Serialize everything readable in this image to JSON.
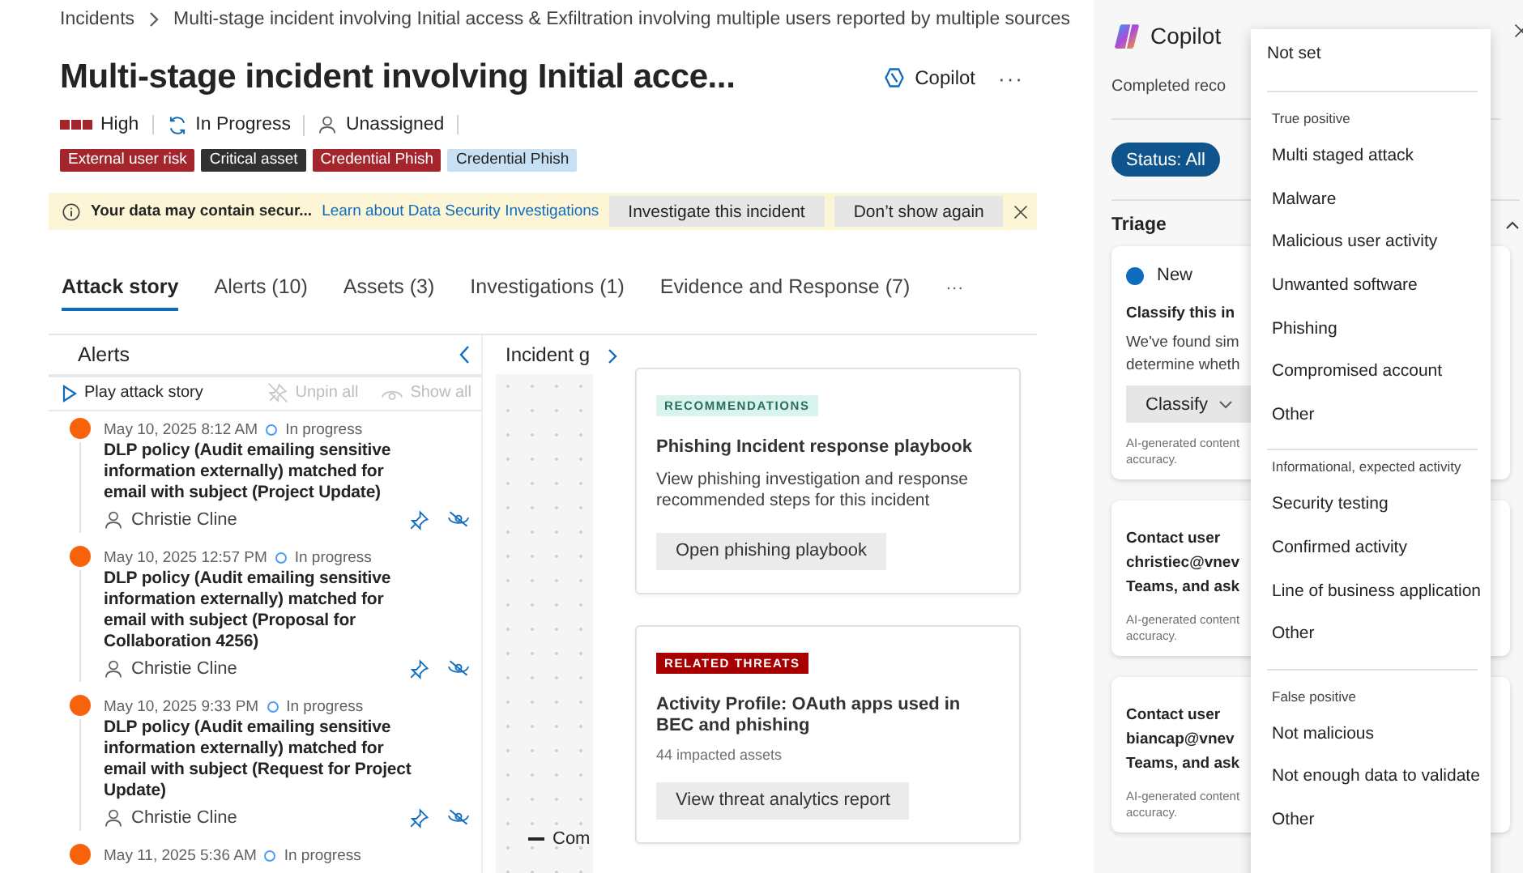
{
  "breadcrumb": {
    "root": "Incidents",
    "current": "Multi-stage incident involving Initial access & Exfiltration involving multiple users reported by multiple sources"
  },
  "title": "Multi-stage incident involving Initial acce...",
  "header_actions": {
    "copilot": "Copilot",
    "more": "···"
  },
  "status": {
    "severity": "High",
    "state": "In Progress",
    "assignee": "Unassigned"
  },
  "tags": [
    {
      "label": "External user risk",
      "color": "#a4262c"
    },
    {
      "label": "Critical asset",
      "color": "#323130"
    },
    {
      "label": "Credential Phish",
      "color": "#a4262c"
    },
    {
      "label": "Credential Phish",
      "color": "#c7e0f4"
    }
  ],
  "banner": {
    "message": "Your data may contain secur...",
    "link": "Learn about Data Security Investigations",
    "buttons": [
      "Investigate this incident",
      "Don’t show again"
    ]
  },
  "tabs": [
    {
      "label": "Attack story",
      "selected": true
    },
    {
      "label": "Alerts (10)",
      "selected": false
    },
    {
      "label": "Assets (3)",
      "selected": false
    },
    {
      "label": "Investigations (1)",
      "selected": false
    },
    {
      "label": "Evidence and Response (7)",
      "selected": false
    }
  ],
  "tabs_more": "···",
  "alerts_panel": {
    "title": "Alerts",
    "toolbar": [
      {
        "kind": "play",
        "label": "Play attack story",
        "disabled": false
      },
      {
        "kind": "unpin",
        "label": "Unpin all",
        "disabled": true
      },
      {
        "kind": "show",
        "label": "Show all",
        "disabled": true
      }
    ],
    "alerts": [
      {
        "time": "May 10, 2025 8:12 AM",
        "status": "In progress",
        "title": "DLP policy (Audit emailing sensitive information externally) matched for email with subject (Project Update)",
        "user": "Christie Cline"
      },
      {
        "time": "May 10, 2025 12:57 PM",
        "status": "In progress",
        "title": "DLP policy (Audit emailing sensitive information externally) matched for email with subject (Proposal for Collaboration 4256)",
        "user": "Christie Cline"
      },
      {
        "time": "May 10, 2025 9:33 PM",
        "status": "In progress",
        "title": "DLP policy (Audit emailing sensitive information externally) matched for email with subject (Request for Project Update)",
        "user": "Christie Cline"
      },
      {
        "time": "May 11, 2025 5:36 AM",
        "status": "In progress"
      }
    ]
  },
  "graph_panel": {
    "title": "Incident g",
    "legend": "Com"
  },
  "cards": [
    {
      "kind": "recommendation",
      "badge": "RECOMMENDATIONS",
      "title": "Phishing Incident response playbook",
      "description": "View phishing investigation and response recommended steps for this incident",
      "button": "Open phishing playbook"
    },
    {
      "kind": "threat",
      "badge": "RELATED THREATS",
      "title": "Activity Profile: OAuth apps used in BEC and phishing",
      "meta": "44 impacted assets",
      "button": "View threat analytics report"
    }
  ],
  "copilot": {
    "title": "Copilot",
    "subtitle": "Completed reco",
    "filter": "Status: All",
    "section": "Triage",
    "cards": [
      {
        "kind": "triage",
        "status": "New",
        "title_lines": [
          "Classify this in"
        ],
        "description_lines": [
          "We've found sim",
          "determine wheth"
        ],
        "button": "Classify",
        "note_lines": [
          "AI-generated content",
          "accuracy."
        ]
      },
      {
        "kind": "task",
        "title_lines": [
          "Contact user",
          "christiec@vnev",
          "Teams, and ask"
        ],
        "note_lines": [
          "AI-generated content",
          "accuracy."
        ]
      },
      {
        "kind": "task",
        "title_lines": [
          "Contact user",
          "biancap@vnev",
          "Teams, and ask"
        ],
        "note_lines": [
          "AI-generated content",
          "accuracy."
        ]
      }
    ]
  },
  "classify_menu": {
    "groups": [
      {
        "items": [
          "Not set"
        ]
      },
      {
        "header": "True positive",
        "items": [
          "Multi staged attack",
          "Malware",
          "Malicious user activity",
          "Unwanted software",
          "Phishing",
          "Compromised account",
          "Other"
        ]
      },
      {
        "header": "Informational, expected activity",
        "items": [
          "Security testing",
          "Confirmed activity",
          "Line of business application",
          "Other"
        ]
      },
      {
        "header": "False positive",
        "items": [
          "Not malicious",
          "Not enough data to validate",
          "Other"
        ]
      }
    ]
  }
}
